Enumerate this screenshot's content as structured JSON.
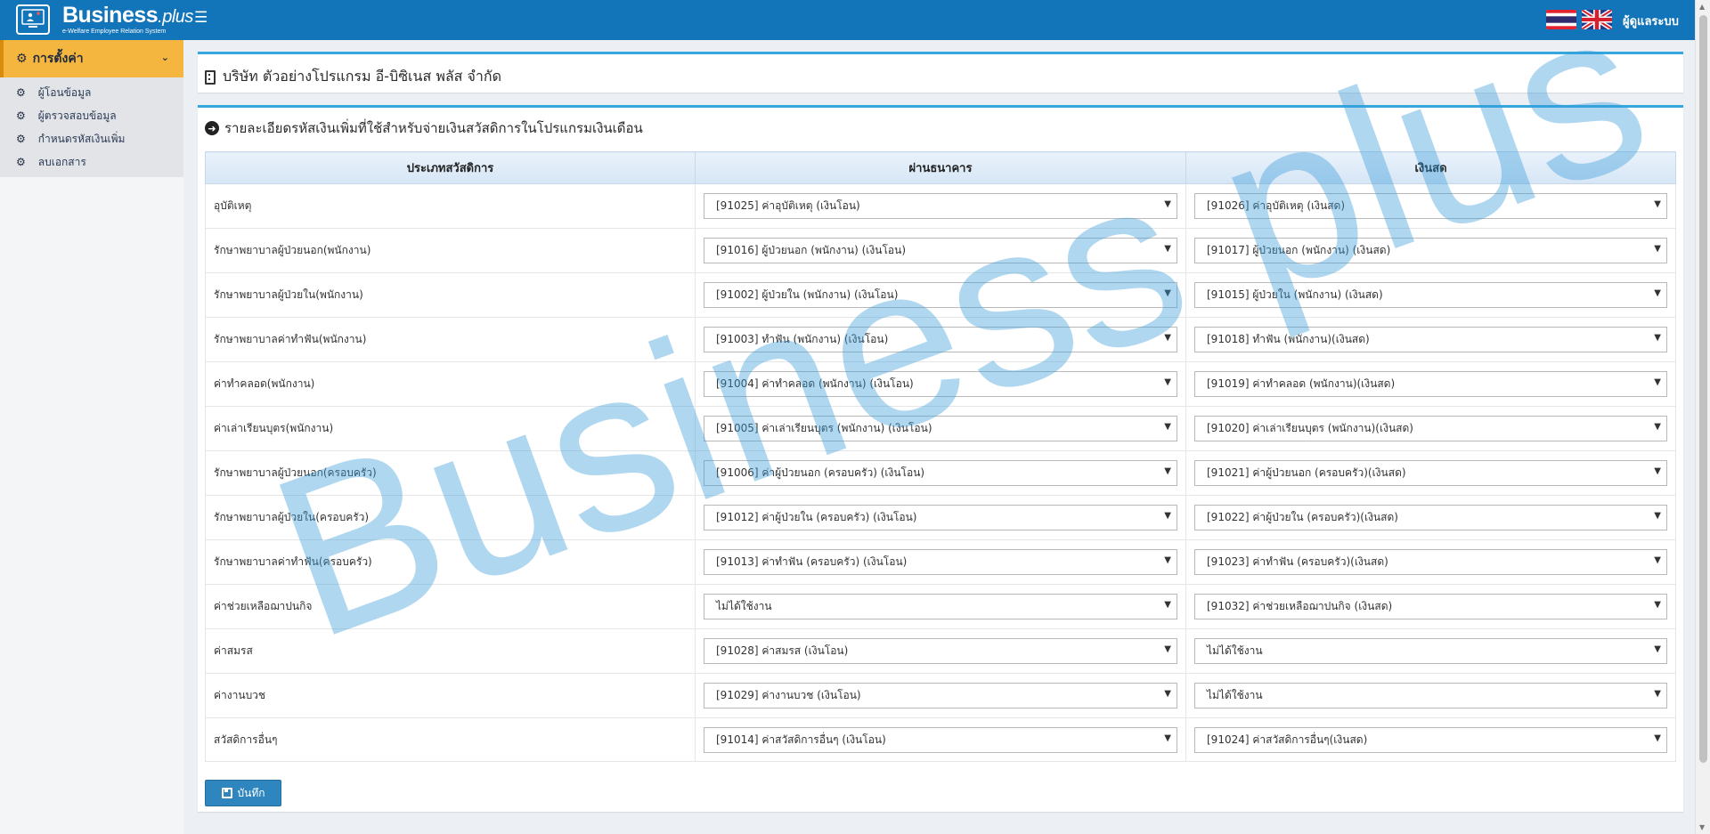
{
  "header": {
    "logo_main": "Business",
    "logo_plus": ".plus",
    "logo_sub": "e-Welfare Employee Relation System",
    "user_label": "ผู้ดูแลระบบ"
  },
  "sidebar": {
    "section_label": "การตั้งค่า",
    "items": [
      {
        "label": "ผู้โอนข้อมูล"
      },
      {
        "label": "ผู้ตรวจสอบข้อมูล"
      },
      {
        "label": "กำหนดรหัสเงินเพิ่ม"
      },
      {
        "label": "ลบเอกสาร"
      }
    ]
  },
  "company": {
    "title": "บริษัท ตัวอย่างโปรแกรม อี-บิซิเนส พลัส จำกัด"
  },
  "main": {
    "section_title": "รายละเอียดรหัสเงินเพิ่มที่ใช้สำหรับจ่ายเงินสวัสดิการในโปรแกรมเงินเดือน",
    "columns": [
      "ประเภทสวัสดิการ",
      "ผ่านธนาคาร",
      "เงินสด"
    ],
    "rows": [
      {
        "type": "อุบัติเหตุ",
        "bank": "[91025] ค่าอุบัติเหตุ (เงินโอน)",
        "cash": "[91026] ค่าอุบัติเหตุ (เงินสด)"
      },
      {
        "type": "รักษาพยาบาลผู้ป่วยนอก(พนักงาน)",
        "bank": "[91016] ผู้ป่วยนอก (พนักงาน) (เงินโอน)",
        "cash": "[91017] ผู้ป่วยนอก (พนักงาน) (เงินสด)"
      },
      {
        "type": "รักษาพยาบาลผู้ป่วยใน(พนักงาน)",
        "bank": "[91002] ผู้ป่วยใน (พนักงาน) (เงินโอน)",
        "cash": "[91015] ผู้ป่วยใน (พนักงาน) (เงินสด)"
      },
      {
        "type": "รักษาพยาบาลค่าทำฟัน(พนักงาน)",
        "bank": "[91003] ทำฟัน (พนักงาน) (เงินโอน)",
        "cash": "[91018] ทำฟัน (พนักงาน)(เงินสด)"
      },
      {
        "type": "ค่าทำคลอด(พนักงาน)",
        "bank": "[91004] ค่าทำคลอด (พนักงาน) (เงินโอน)",
        "cash": "[91019] ค่าทำคลอด (พนักงาน)(เงินสด)"
      },
      {
        "type": "ค่าเล่าเรียนบุตร(พนักงาน)",
        "bank": "[91005] ค่าเล่าเรียนบุตร (พนักงาน) (เงินโอน)",
        "cash": "[91020] ค่าเล่าเรียนบุตร (พนักงาน)(เงินสด)"
      },
      {
        "type": "รักษาพยาบาลผู้ป่วยนอก(ครอบครัว)",
        "bank": "[91006] ค่าผู้ป่วยนอก (ครอบครัว) (เงินโอน)",
        "cash": "[91021] ค่าผู้ป่วยนอก (ครอบครัว)(เงินสด)"
      },
      {
        "type": "รักษาพยาบาลผู้ป่วยใน(ครอบครัว)",
        "bank": "[91012] ค่าผู้ป่วยใน (ครอบครัว) (เงินโอน)",
        "cash": "[91022] ค่าผู้ป่วยใน (ครอบครัว)(เงินสด)"
      },
      {
        "type": "รักษาพยาบาลค่าทำฟัน(ครอบครัว)",
        "bank": "[91013] ค่าทำฟัน (ครอบครัว) (เงินโอน)",
        "cash": "[91023] ค่าทำฟัน (ครอบครัว)(เงินสด)"
      },
      {
        "type": "ค่าช่วยเหลือฌาปนกิจ",
        "bank": "ไม่ได้ใช้งาน",
        "cash": "[91032] ค่าช่วยเหลือฌาปนกิจ (เงินสด)"
      },
      {
        "type": "ค่าสมรส",
        "bank": "[91028] ค่าสมรส (เงินโอน)",
        "cash": "ไม่ได้ใช้งาน"
      },
      {
        "type": "ค่างานบวช",
        "bank": "[91029] ค่างานบวช (เงินโอน)",
        "cash": "ไม่ได้ใช้งาน"
      },
      {
        "type": "สวัสดิการอื่นๆ",
        "bank": "[91014] ค่าสวัสดิการอื่นๆ (เงินโอน)",
        "cash": "[91024] ค่าสวัสดิการอื่นๆ(เงินสด)"
      }
    ],
    "save_label": "บันทึก"
  },
  "watermark": {
    "text": "Business plus",
    "color": "#3a9ad9"
  },
  "colors": {
    "header_bg": "#1274b9",
    "sidebar_active": "#f4b63f",
    "panel_accent": "#35a7dd",
    "save_button": "#2f86bf"
  }
}
